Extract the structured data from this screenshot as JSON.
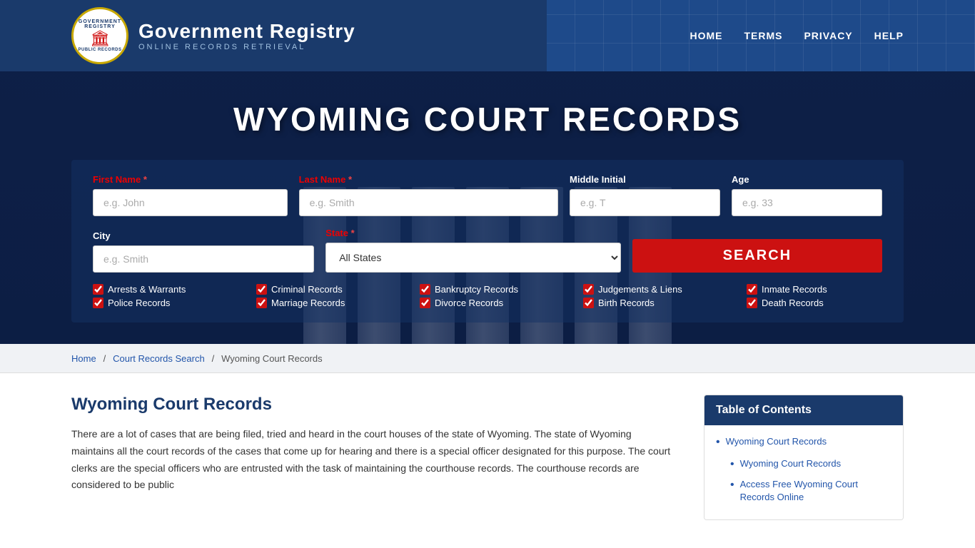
{
  "header": {
    "logo_top_text": "Government Registry",
    "logo_bottom_text": "Public Records",
    "brand_name": "Government Registry",
    "brand_sub": "Online Records Retrieval",
    "nav": [
      {
        "label": "HOME",
        "href": "#"
      },
      {
        "label": "TERMS",
        "href": "#"
      },
      {
        "label": "PRIVACY",
        "href": "#"
      },
      {
        "label": "HELP",
        "href": "#"
      }
    ]
  },
  "hero": {
    "title": "Wyoming Court Records",
    "form": {
      "first_name_label": "First Name",
      "first_name_placeholder": "e.g. John",
      "last_name_label": "Last Name",
      "last_name_placeholder": "e.g. Smith",
      "middle_initial_label": "Middle Initial",
      "middle_initial_placeholder": "e.g. T",
      "age_label": "Age",
      "age_placeholder": "e.g. 33",
      "city_label": "City",
      "city_placeholder": "e.g. Smith",
      "state_label": "State",
      "state_default": "All States",
      "search_button": "SEARCH"
    },
    "checkboxes": [
      {
        "col": 0,
        "label": "Arrests & Warrants",
        "checked": true
      },
      {
        "col": 0,
        "label": "Police Records",
        "checked": true
      },
      {
        "col": 1,
        "label": "Criminal Records",
        "checked": true
      },
      {
        "col": 1,
        "label": "Marriage Records",
        "checked": true
      },
      {
        "col": 2,
        "label": "Bankruptcy Records",
        "checked": true
      },
      {
        "col": 2,
        "label": "Divorce Records",
        "checked": true
      },
      {
        "col": 3,
        "label": "Judgements & Liens",
        "checked": true
      },
      {
        "col": 3,
        "label": "Birth Records",
        "checked": true
      },
      {
        "col": 4,
        "label": "Inmate Records",
        "checked": true
      },
      {
        "col": 4,
        "label": "Death Records",
        "checked": true
      }
    ]
  },
  "breadcrumb": {
    "items": [
      {
        "label": "Home",
        "href": "#"
      },
      {
        "label": "Court Records Search",
        "href": "#"
      },
      {
        "label": "Wyoming Court Records",
        "href": "#"
      }
    ]
  },
  "article": {
    "title": "Wyoming Court Records",
    "body": "There are a lot of cases that are being filed, tried and heard in the court houses of the state of Wyoming. The state of Wyoming maintains all the court records of the cases that come up for hearing and there is a special officer designated for this purpose. The court clerks are the special officers who are entrusted with the task of maintaining the courthouse records. The courthouse records are considered to be public"
  },
  "toc": {
    "header": "Table of Contents",
    "items": [
      {
        "label": "Wyoming Court Records",
        "href": "#",
        "indent": 0
      },
      {
        "label": "Wyoming Court Records",
        "href": "#",
        "indent": 1
      },
      {
        "label": "Access Free Wyoming Court Records Online",
        "href": "#",
        "indent": 1
      }
    ]
  }
}
